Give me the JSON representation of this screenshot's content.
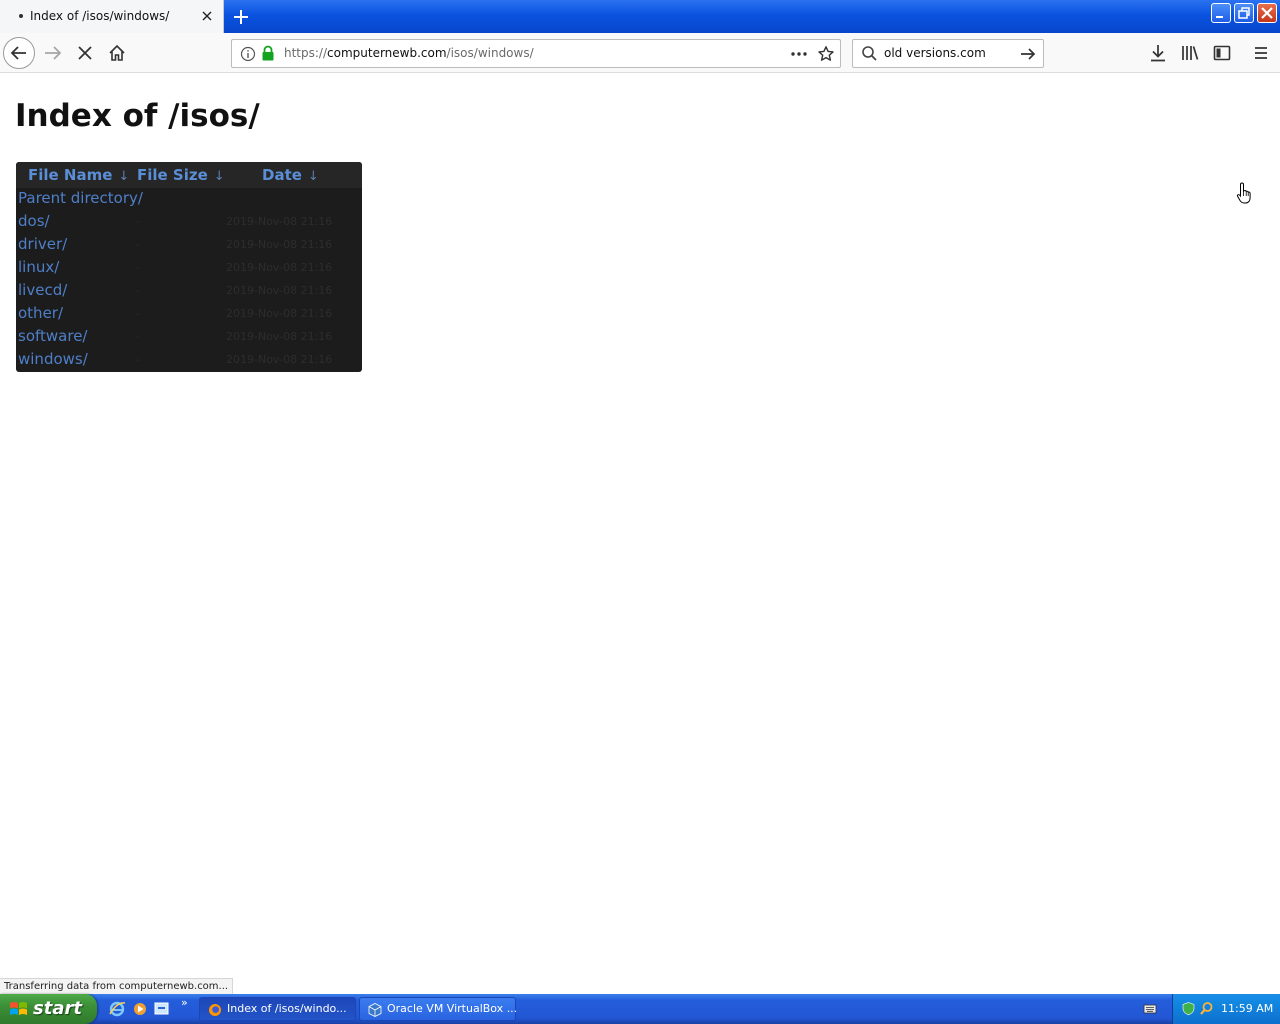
{
  "browser": {
    "tab": {
      "title": "Index of /isos/windows/"
    },
    "url": {
      "scheme": "https://",
      "host": "computernewb.com",
      "path": "/isos/windows/"
    },
    "search": {
      "value": "old versions.com"
    }
  },
  "page": {
    "title": "Index of /isos/",
    "columns": {
      "name": "File Name",
      "size": "File Size",
      "date": "Date",
      "sort_arrow": "↓"
    },
    "rows": [
      {
        "name": "Parent directory/",
        "size": "",
        "date": ""
      },
      {
        "name": "dos/",
        "size": "-",
        "date": "2019-Nov-08 21:16"
      },
      {
        "name": "driver/",
        "size": "-",
        "date": "2019-Nov-08 21:16"
      },
      {
        "name": "linux/",
        "size": "-",
        "date": "2019-Nov-08 21:16"
      },
      {
        "name": "livecd/",
        "size": "-",
        "date": "2019-Nov-08 21:16"
      },
      {
        "name": "other/",
        "size": "-",
        "date": "2019-Nov-08 21:16"
      },
      {
        "name": "software/",
        "size": "-",
        "date": "2019-Nov-08 21:16"
      },
      {
        "name": "windows/",
        "size": "-",
        "date": "2019-Nov-08 21:16"
      }
    ]
  },
  "status": {
    "text": "Transferring data from computernewb.com..."
  },
  "taskbar": {
    "start_label": "start",
    "tasks": [
      {
        "label": "Index of /isos/windo..."
      },
      {
        "label": "Oracle VM VirtualBox ..."
      }
    ],
    "quicklaunch_more": "»",
    "clock": "11:59 AM"
  },
  "colors": {
    "accent": "#5a8ed6",
    "listing_bg": "#1c1c1c",
    "xp_taskbar": "#245edb",
    "xp_start": "#3c8f37"
  },
  "icons": [
    "close-icon",
    "plus-icon",
    "back-arrow-icon",
    "forward-arrow-icon",
    "stop-icon",
    "home-icon",
    "info-icon",
    "lock-icon",
    "more-icon",
    "star-icon",
    "search-icon",
    "go-arrow-icon",
    "download-icon",
    "library-icon",
    "sidebar-icon",
    "menu-icon",
    "hand-cursor-icon"
  ]
}
